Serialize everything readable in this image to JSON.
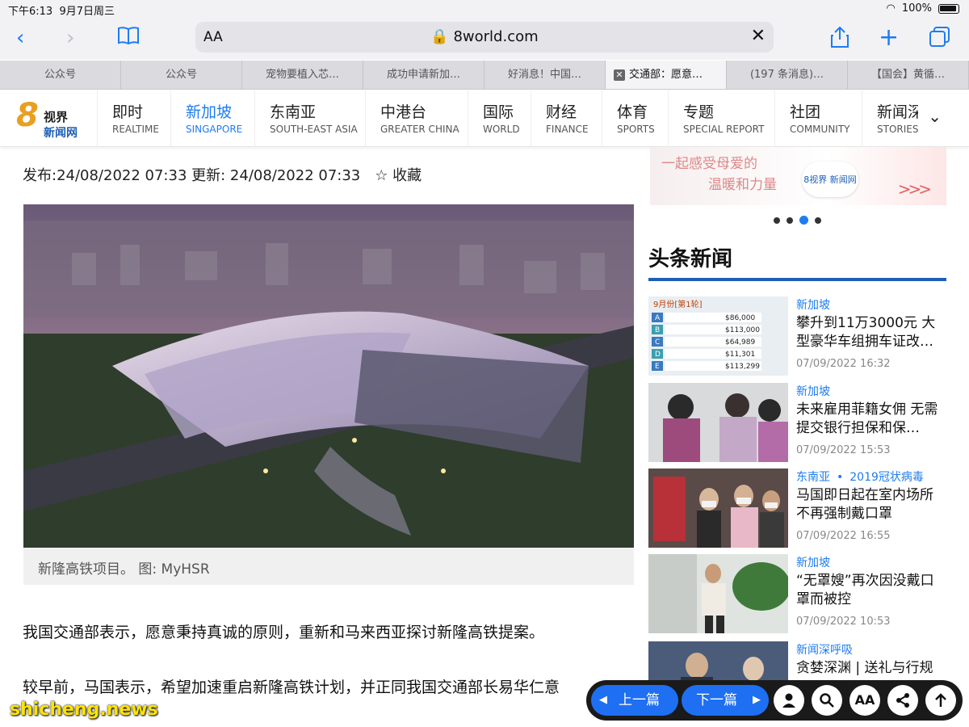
{
  "status": {
    "time": "下午6:13",
    "date": "9月7日周三",
    "battery": "100%"
  },
  "browser": {
    "aa": "AA",
    "url": "8world.com"
  },
  "tabs": [
    "公众号",
    "公众号",
    "宠物要植入芯…",
    "成功申请新加…",
    "好消息！中国…",
    "交通部：愿意…",
    "(197 条消息)…",
    "【国会】黄循…"
  ],
  "site": {
    "logo_num": "8",
    "logo_line1": "视界",
    "logo_line2": "新闻网",
    "nav": [
      {
        "zh": "即时",
        "en": "REALTIME"
      },
      {
        "zh": "新加坡",
        "en": "SINGAPORE"
      },
      {
        "zh": "东南亚",
        "en": "SOUTH-EAST ASIA"
      },
      {
        "zh": "中港台",
        "en": "GREATER CHINA"
      },
      {
        "zh": "国际",
        "en": "WORLD"
      },
      {
        "zh": "财经",
        "en": "FINANCE"
      },
      {
        "zh": "体育",
        "en": "SPORTS"
      },
      {
        "zh": "专题",
        "en": "SPECIAL REPORT"
      },
      {
        "zh": "社团",
        "en": "COMMUNITY"
      },
      {
        "zh": "新闻深",
        "en": "STORIES"
      }
    ]
  },
  "article": {
    "meta": "发布:24/08/2022 07:33  更新: 24/08/2022 07:33",
    "save": "☆ 收藏",
    "caption": "新隆高铁项目。   图: MyHSR",
    "para1": "我国交通部表示，愿意秉持真诚的原则，重新和马来西亚探讨新隆高铁提案。",
    "para2": "较早前，马国表示，希望加速重启新隆高铁计划，并正同我国交通部长易华仁意"
  },
  "banner": {
    "line1": "一起感受母爱的",
    "line2": "温暖和力量",
    "logo": "8视界 新闻网"
  },
  "headlines": {
    "title": "头条新闻",
    "items": [
      {
        "cat": "新加坡",
        "title": "攀升到11万3000元 大型豪华车组拥车证改…",
        "date": "07/09/2022 16:32"
      },
      {
        "cat": "新加坡",
        "title": "未来雇用菲籍女佣 无需提交银行担保和保…",
        "date": "07/09/2022 15:53"
      },
      {
        "cat": "东南亚",
        "cat2": "2019冠状病毒",
        "title": "马国即日起在室内场所不再强制戴口罩",
        "date": "07/09/2022 16:55"
      },
      {
        "cat": "新加坡",
        "title": "“无罩嫂”再次因没戴口罩而被控",
        "date": "07/09/2022 10:53"
      },
      {
        "cat": "新闻深呼吸",
        "title": "贪婪深渊 | 送礼与行规",
        "date": ""
      }
    ]
  },
  "thumb_coe": {
    "header": "9月份[第1轮]",
    "rows": [
      {
        "cat": "A",
        "value": "$86,000"
      },
      {
        "cat": "B",
        "value": "$113,000"
      },
      {
        "cat": "C",
        "value": "$64,989"
      },
      {
        "cat": "D",
        "value": "$11,301"
      },
      {
        "cat": "E",
        "value": "$113,299"
      }
    ]
  },
  "bottom": {
    "prev": "上一篇",
    "next": "下一篇"
  },
  "watermark": "shicheng.news"
}
